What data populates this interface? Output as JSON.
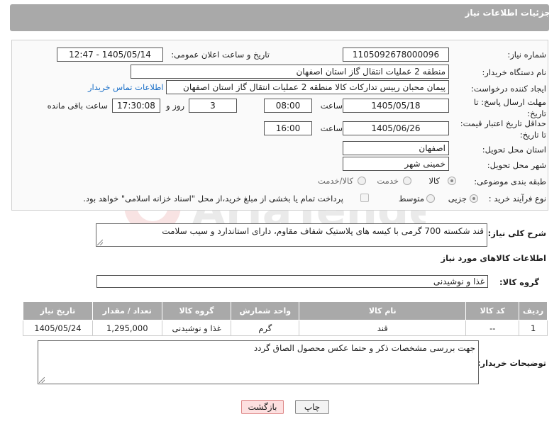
{
  "header": {
    "title": "جزئیات اطلاعات نیاز"
  },
  "form": {
    "need_number": {
      "label": "شماره نیاز:",
      "value": "1105092678000096"
    },
    "announce_datetime": {
      "label": "تاریخ و ساعت اعلان عمومی:",
      "value": "1405/05/14 - 12:47"
    },
    "buyer_org": {
      "label": "نام دستگاه خریدار:",
      "value": "منطقه 2 عملیات انتقال گاز استان اصفهان"
    },
    "requester": {
      "label": "ایجاد کننده درخواست:",
      "value": "پیمان محبان رییس تدارکات کالا منطقه 2 عملیات انتقال گاز استان اصفهان",
      "contact_link": "اطلاعات تماس خریدار"
    },
    "reply_deadline": {
      "label": "مهلت ارسال پاسخ: تا تاریخ:",
      "date": "1405/05/18",
      "time_label": "ساعت",
      "time": "08:00",
      "days": "3",
      "days_label": "روز و",
      "remaining": "17:30:08",
      "remaining_label": "ساعت باقی مانده"
    },
    "price_validity": {
      "label": "حداقل تاریخ اعتبار قیمت: تا تاریخ:",
      "date": "1405/06/26",
      "time_label": "ساعت",
      "time": "16:00"
    },
    "delivery_province": {
      "label": "استان محل تحویل:",
      "value": "اصفهان"
    },
    "delivery_city": {
      "label": "شهر محل تحویل:",
      "value": "خمینی شهر"
    },
    "category": {
      "label": "طبقه بندی موضوعی:",
      "options": [
        "کالا",
        "خدمت",
        "کالا/خدمت"
      ],
      "selected": "کالا"
    },
    "process_type": {
      "label": "نوع فرآیند خرید :",
      "options": [
        "جزیی",
        "متوسط"
      ],
      "selected": "جزیی",
      "payment_note": "پرداخت تمام یا بخشی از مبلغ خرید،از محل \"اسناد خزانه اسلامی\" خواهد بود."
    }
  },
  "description": {
    "label": "شرح کلی نیاز:",
    "value": "قند شکسته 700 گرمی با کیسه های پلاستیک شفاف مقاوم، دارای استاندارد و سیب سلامت"
  },
  "goods_info": {
    "title": "اطلاعات کالاهای مورد نیاز",
    "group_label": "گروه کالا:",
    "group_value": "غذا و نوشیدنی"
  },
  "items_table": {
    "columns": [
      "ردیف",
      "کد کالا",
      "نام کالا",
      "واحد شمارش",
      "گروه کالا",
      "تعداد / مقدار",
      "تاریخ نیاز"
    ],
    "rows": [
      [
        "1",
        "--",
        "قند",
        "گرم",
        "غذا و نوشیدنی",
        "1,295,000",
        "1405/05/24"
      ]
    ]
  },
  "buyer_notes": {
    "label": "توضیحات خریدار:",
    "value": "جهت بررسی مشخصات ذکر و حتما عکس محصول الصاق گردد"
  },
  "buttons": {
    "print": "چاپ",
    "back": "بازگشت"
  },
  "watermark": {
    "text": "AriaTender.net"
  },
  "colors": {
    "header_bg": "#a9a9a9",
    "link": "#1a6fc7",
    "back_button_bg": "#fde0e0"
  }
}
